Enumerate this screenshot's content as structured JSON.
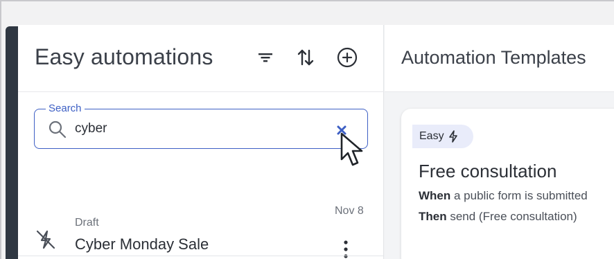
{
  "left_panel": {
    "title": "Easy automations",
    "search": {
      "label": "Search",
      "value": "cyber"
    },
    "items": [
      {
        "status": "Draft",
        "title": "Cyber Monday Sale",
        "date": "Nov 8",
        "icon": "automation-off-icon"
      }
    ]
  },
  "right_panel": {
    "title": "Automation Templates",
    "template_card": {
      "badge": "Easy",
      "title": "Free consultation",
      "when_keyword": "When",
      "when_text": " a public form is submitted",
      "then_keyword": "Then",
      "then_text": " send (Free consultation)"
    }
  },
  "colors": {
    "accent": "#3d5fc4",
    "sidebar_dark": "#2f3742",
    "badge_bg": "#e9ecfa"
  }
}
